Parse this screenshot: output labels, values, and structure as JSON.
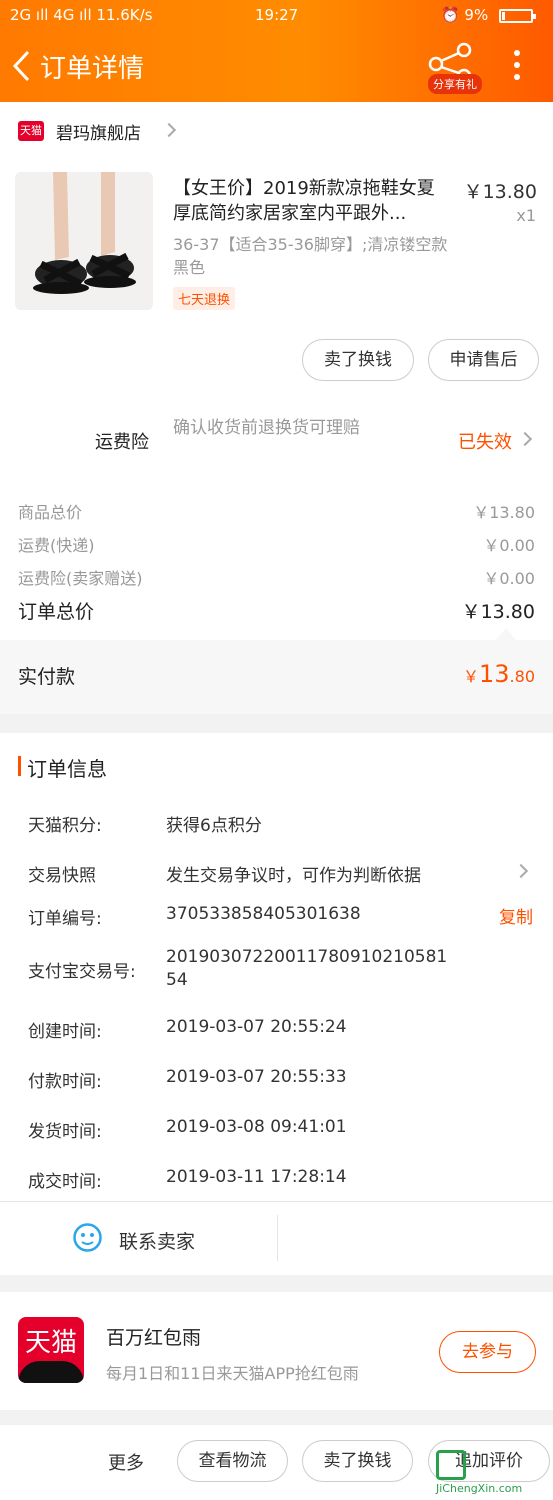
{
  "status_bar": {
    "left": "2G ıll 4G ıll 11.6K/s",
    "time": "19:27",
    "battery": "9%"
  },
  "header": {
    "title": "订单详情",
    "share_label": "分享有礼"
  },
  "store": {
    "badge": "天猫",
    "name": "碧玛旗舰店"
  },
  "product": {
    "title": "【女王价】2019新款凉拖鞋女夏厚底简约家居家室内平跟外...",
    "price": "￥13.80",
    "qty": "x1",
    "sku": "36-37【适合35-36脚穿】;清凉镂空款黑色",
    "tag": "七天退换"
  },
  "item_actions": {
    "sell": "卖了换钱",
    "aftersale": "申请售后"
  },
  "insurance": {
    "label": "运费险",
    "desc": "确认收货前退换货可理赔",
    "status": "已失效"
  },
  "fees": [
    {
      "label": "商品总价",
      "value": "￥13.80"
    },
    {
      "label": "运费(快递)",
      "value": "￥0.00"
    },
    {
      "label": "运费险(卖家赠送)",
      "value": "￥0.00"
    }
  ],
  "total": {
    "label": "订单总价",
    "value": "￥13.80"
  },
  "paid": {
    "label": "实付款",
    "currency": "￥",
    "int": "13",
    "dec": ".80"
  },
  "order_info": {
    "title": "订单信息",
    "rows": [
      {
        "k": "天猫积分:",
        "v": "获得6点积分"
      },
      {
        "k": "交易快照",
        "v": "发生交易争议时，可作为判断依据"
      },
      {
        "k": "订单编号:",
        "v": "370533858405301638"
      },
      {
        "k": "支付宝交易号:",
        "v": "2019030722001178091021058154"
      },
      {
        "k": "创建时间:",
        "v": "2019-03-07 20:55:24"
      },
      {
        "k": "付款时间:",
        "v": "2019-03-07 20:55:33"
      },
      {
        "k": "发货时间:",
        "v": "2019-03-08 09:41:01"
      },
      {
        "k": "成交时间:",
        "v": "2019-03-11 17:28:14"
      }
    ],
    "copy": "复制"
  },
  "contact": {
    "label": "联系卖家"
  },
  "promo": {
    "logo_text": "天猫",
    "title": "百万红包雨",
    "desc": "每月1日和11日来天猫APP抢红包雨",
    "button": "去参与"
  },
  "bottom_bar": {
    "more": "更多",
    "logistics": "查看物流",
    "sell": "卖了换钱",
    "review": "追加评价"
  },
  "watermark": {
    "text": "JiChengXin.com"
  },
  "colors": {
    "accent": "#ff5000",
    "header": "#ff7a00"
  }
}
